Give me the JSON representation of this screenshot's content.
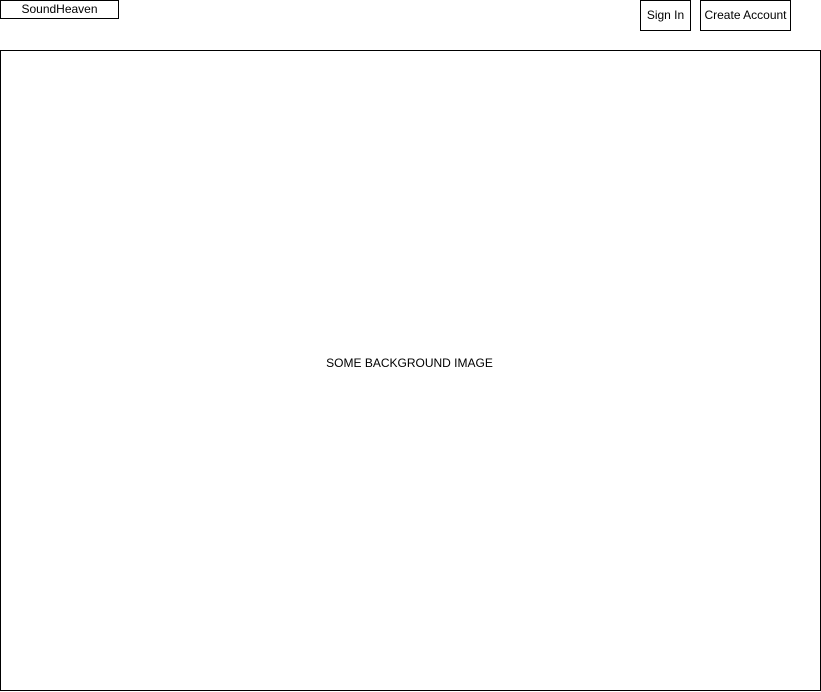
{
  "header": {
    "logo_text": "SoundHeaven",
    "sign_in_label": "Sign In",
    "create_account_label": "Create Account"
  },
  "hero": {
    "placeholder_text": "SOME BACKGROUND IMAGE"
  }
}
